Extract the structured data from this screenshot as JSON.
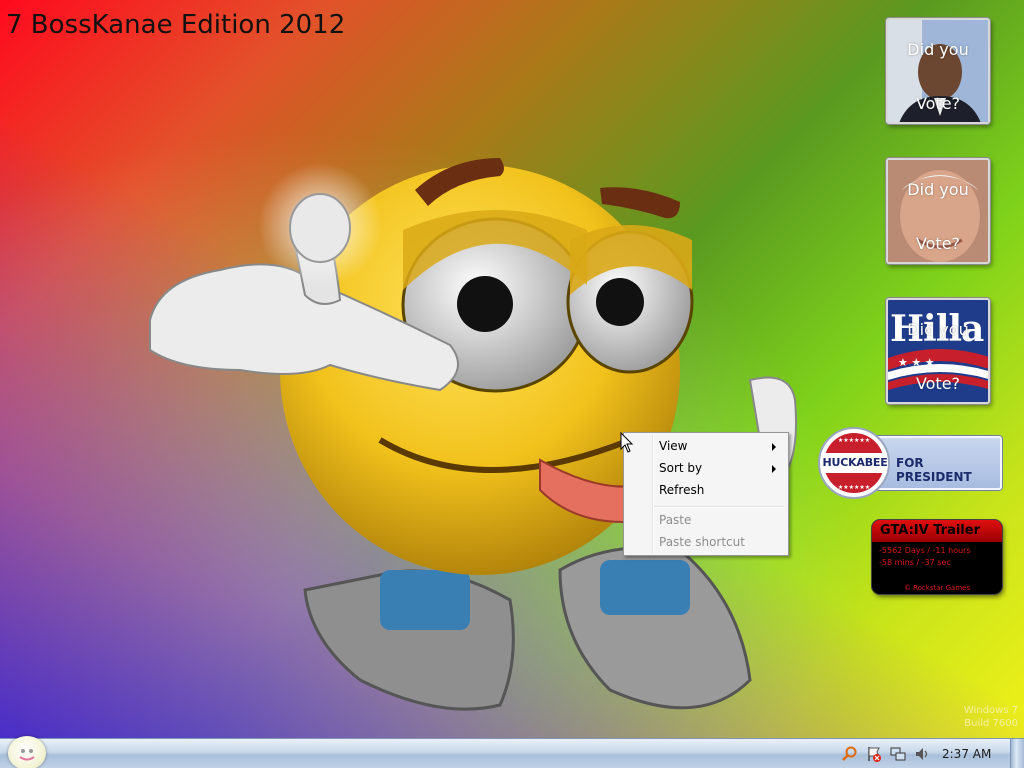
{
  "desktop": {
    "title": "7 BossKanae Edition 2012",
    "watermark_line1": "Windows 7",
    "watermark_line2": "Build 7600"
  },
  "gadgets": {
    "obama": {
      "line1": "Did you",
      "line2": "Vote?"
    },
    "mccain": {
      "line1": "Did you",
      "line2": "Vote?"
    },
    "hillary": {
      "poster_text": "Hilla",
      "line1": "Did you",
      "line2": "Vote?"
    },
    "huckabee": {
      "name": "HUCKABEE",
      "slogan": "FOR PRESIDENT"
    },
    "gta": {
      "title": "GTA:IV Trailer",
      "countdown_line1": "-5562 Days / -11 hours",
      "countdown_line2": "-58 mins / -37 sec",
      "copyright": "© Rockstar Games"
    }
  },
  "context_menu": {
    "items": [
      {
        "label": "View",
        "has_submenu": true,
        "enabled": true
      },
      {
        "label": "Sort by",
        "has_submenu": true,
        "enabled": true
      },
      {
        "label": "Refresh",
        "has_submenu": false,
        "enabled": true
      },
      {
        "label": "Paste",
        "has_submenu": false,
        "enabled": false
      },
      {
        "label": "Paste shortcut",
        "has_submenu": false,
        "enabled": false
      }
    ]
  },
  "taskbar": {
    "clock": "2:37 AM",
    "tray_icons": [
      "search-icon",
      "action-center-flag-icon",
      "network-icon",
      "volume-icon"
    ]
  },
  "colors": {
    "gadget_text": "#ffffff",
    "gta_red": "#e01a1a",
    "huckabee_blue": "#1b2a6b",
    "taskbar_top": "#e9f0f8",
    "smiley_yellow": "#f2c21c"
  }
}
